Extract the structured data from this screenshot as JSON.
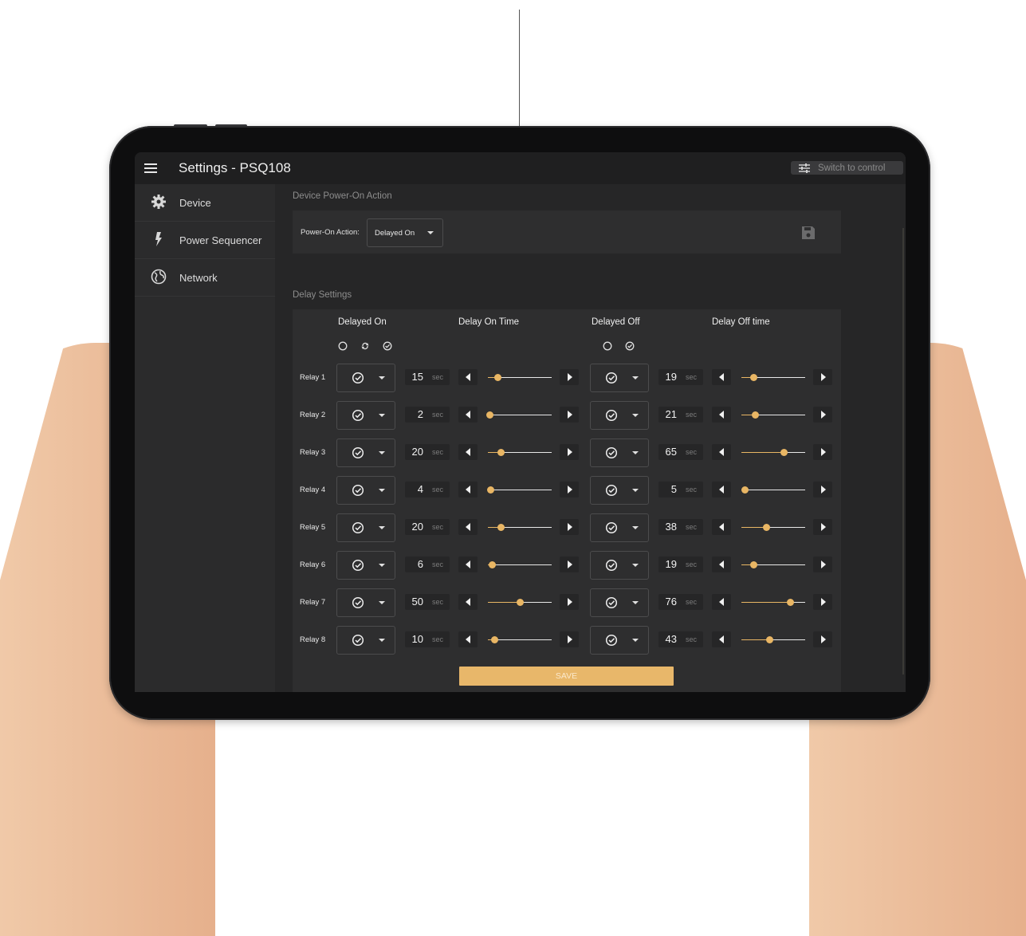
{
  "app": {
    "title": "Settings - PSQ108",
    "switch_label": "Switch to control"
  },
  "sidebar": {
    "items": [
      {
        "label": "Device",
        "icon": "gear-icon"
      },
      {
        "label": "Power Sequencer",
        "icon": "bolt-icon"
      },
      {
        "label": "Network",
        "icon": "globe-icon"
      }
    ]
  },
  "power_on": {
    "section_title": "Device Power-On Action",
    "label": "Power-On Action:",
    "value": "Delayed On"
  },
  "delay": {
    "section_title": "Delay Settings",
    "headers": {
      "delayed_on": "Delayed On",
      "delay_on_time": "Delay On Time",
      "delayed_off": "Delayed Off",
      "delay_off_time": "Delay Off time"
    },
    "unit": "sec",
    "max_seconds": 99,
    "relays": [
      {
        "label": "Relay 1",
        "on": 15,
        "off": 19
      },
      {
        "label": "Relay 2",
        "on": 2,
        "off": 21
      },
      {
        "label": "Relay 3",
        "on": 20,
        "off": 65
      },
      {
        "label": "Relay 4",
        "on": 4,
        "off": 5
      },
      {
        "label": "Relay 5",
        "on": 20,
        "off": 38
      },
      {
        "label": "Relay 6",
        "on": 6,
        "off": 19
      },
      {
        "label": "Relay 7",
        "on": 50,
        "off": 76
      },
      {
        "label": "Relay 8",
        "on": 10,
        "off": 43
      }
    ],
    "save_label": "SAVE"
  },
  "colors": {
    "accent": "#e9b664",
    "background": "#262627"
  }
}
